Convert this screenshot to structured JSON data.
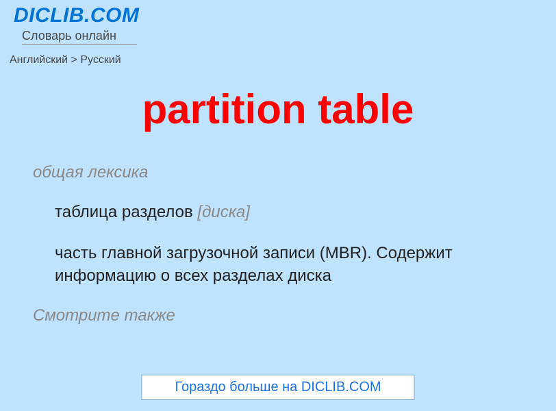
{
  "header": {
    "site_title": "DICLIB.COM",
    "subtitle": "Словарь онлайн"
  },
  "breadcrumb": {
    "from": "Английский",
    "separator": ">",
    "to": "Русский"
  },
  "entry": {
    "title": "partition table",
    "category": "общая лексика",
    "definition_main": "таблица разделов ",
    "definition_qualifier": "[диска]",
    "description": "часть главной загрузочной записи (MBR). Содержит информацию о всех разделах диска",
    "see_also_label": "Смотрите также"
  },
  "footer": {
    "more_button": "Гораздо больше на DICLIB.COM"
  }
}
